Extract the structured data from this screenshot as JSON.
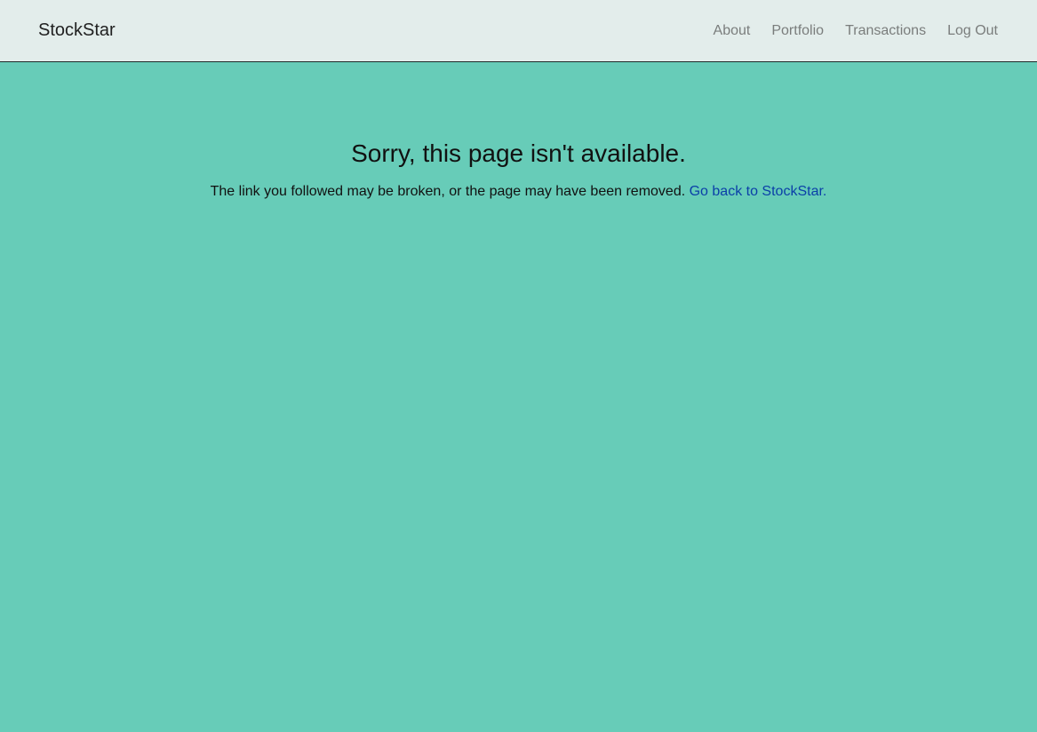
{
  "navbar": {
    "brand": "StockStar",
    "links": [
      {
        "label": "About"
      },
      {
        "label": "Portfolio"
      },
      {
        "label": "Transactions"
      },
      {
        "label": "Log Out"
      }
    ]
  },
  "error": {
    "title": "Sorry, this page isn't available.",
    "message": "The link you followed may be broken, or the page may have been removed.",
    "back_link": "Go back to StockStar."
  },
  "colors": {
    "page_background": "#67ccb8",
    "navbar_background": "#e3edeb",
    "link": "#0b3fa8"
  }
}
